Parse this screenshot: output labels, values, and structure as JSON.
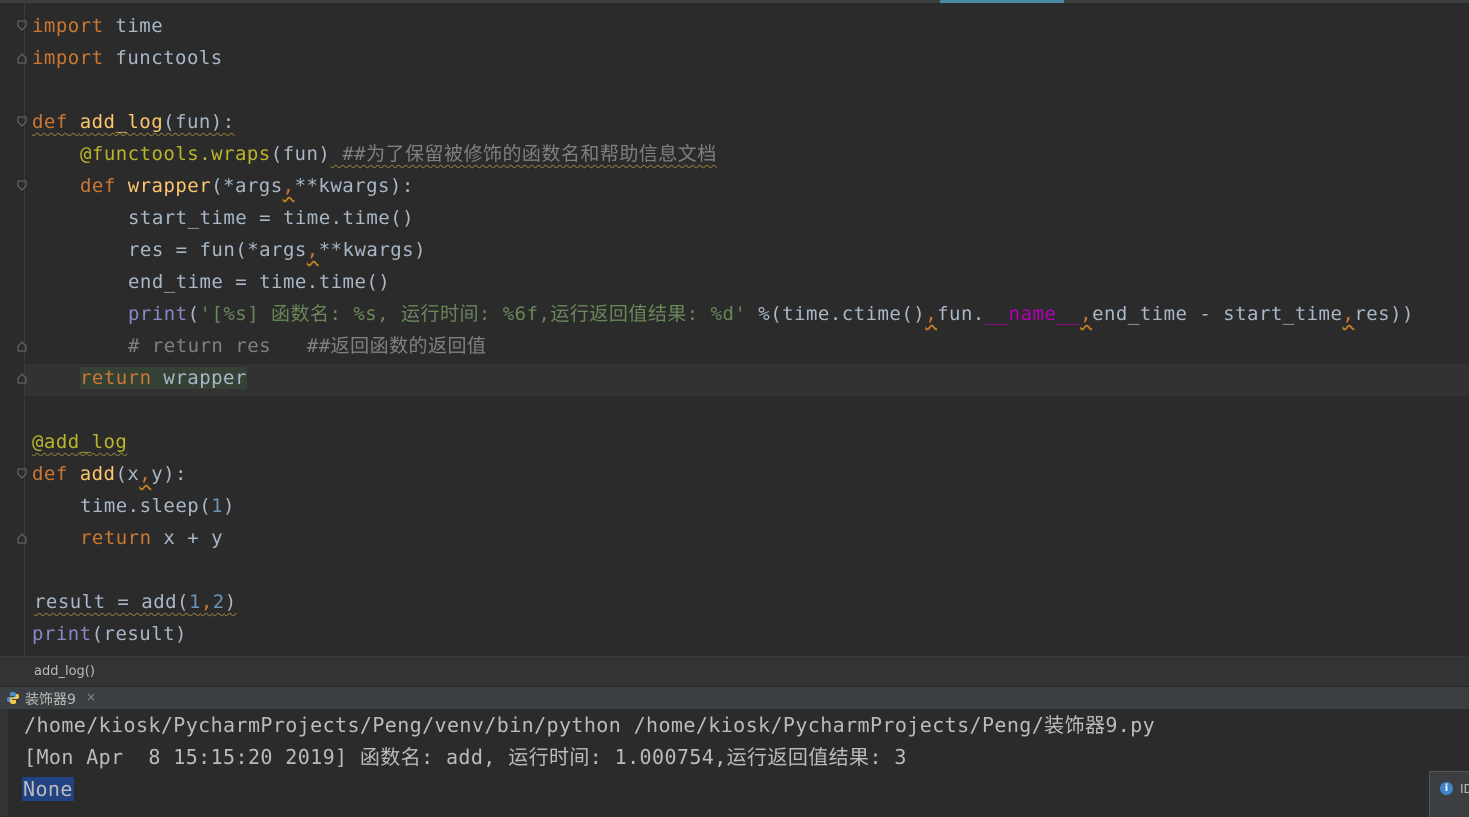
{
  "editor": {
    "lines": {
      "l1": {
        "kw": "import",
        "rest": " time"
      },
      "l2": {
        "kw": "import",
        "rest": " functools"
      },
      "l4": {
        "kw": "def",
        "name": "add_log",
        "sig": "(fun):"
      },
      "l5": {
        "deco": "@functools.wraps",
        "args": "(fun)",
        "comment": " ##为了保留被修饰的函数名和帮助信息文档"
      },
      "l6": {
        "kw": "def",
        "name": "wrapper",
        "a1": "(*args",
        "comma": ",",
        "a2": "**kwargs):"
      },
      "l7": {
        "text": "start_time = time.time()"
      },
      "l8": {
        "p1": "res = fun(*args",
        "comma": ",",
        "p2": "**kwargs)"
      },
      "l9": {
        "text": "end_time = time.time()"
      },
      "l10": {
        "builtin": "print",
        "open": "(",
        "str": "'[%s] 函数名: %s, 运行时间: %6f,运行返回值结果: %d'",
        "op": " %(",
        "c1": "time.ctime()",
        "comma1": ",",
        "c2": "fun.",
        "magic": "__name__",
        "comma2": ",",
        "c3": "end_time - start_time",
        "comma3": ",",
        "c4": "res))"
      },
      "l11": {
        "comment": "# return res   ##返回函数的返回值"
      },
      "l12": {
        "kw": "return",
        "rest": " wrapper"
      },
      "l14": {
        "deco": "@add_log"
      },
      "l15": {
        "kw": "def",
        "name": "add",
        "a1": "(x",
        "comma": ",",
        "a2": "y):"
      },
      "l16": {
        "p1": "time.sleep(",
        "num": "1",
        "p2": ")"
      },
      "l17": {
        "kw": "return",
        "rest": " x + y"
      },
      "l19": {
        "p1": "result = add(",
        "n1": "1",
        "comma": ",",
        "n2": "2",
        "p2": ")"
      },
      "l20": {
        "builtin": "print",
        "rest": "(result)"
      }
    }
  },
  "breadcrumb": {
    "text": "add_log()"
  },
  "run_panel": {
    "tab_label": "装饰器9",
    "close": "×",
    "console_lines": {
      "cmd": "/home/kiosk/PycharmProjects/Peng/venv/bin/python /home/kiosk/PycharmProjects/Peng/装饰器9.py",
      "out": "[Mon Apr  8 15:15:20 2019] 函数名: add, 运行时间: 1.000754,运行返回值结果: 3",
      "none": "None"
    }
  },
  "notification": {
    "icon": "i",
    "text": "ID"
  },
  "colors": {
    "background": "#2b2b2b",
    "keyword": "#cc7832",
    "function": "#ffc66d",
    "decorator": "#bbb529",
    "string": "#6a8759",
    "comment": "#808080",
    "number": "#6897bb",
    "builtin": "#8888c6",
    "magic": "#b200b2",
    "selection": "#214283"
  }
}
